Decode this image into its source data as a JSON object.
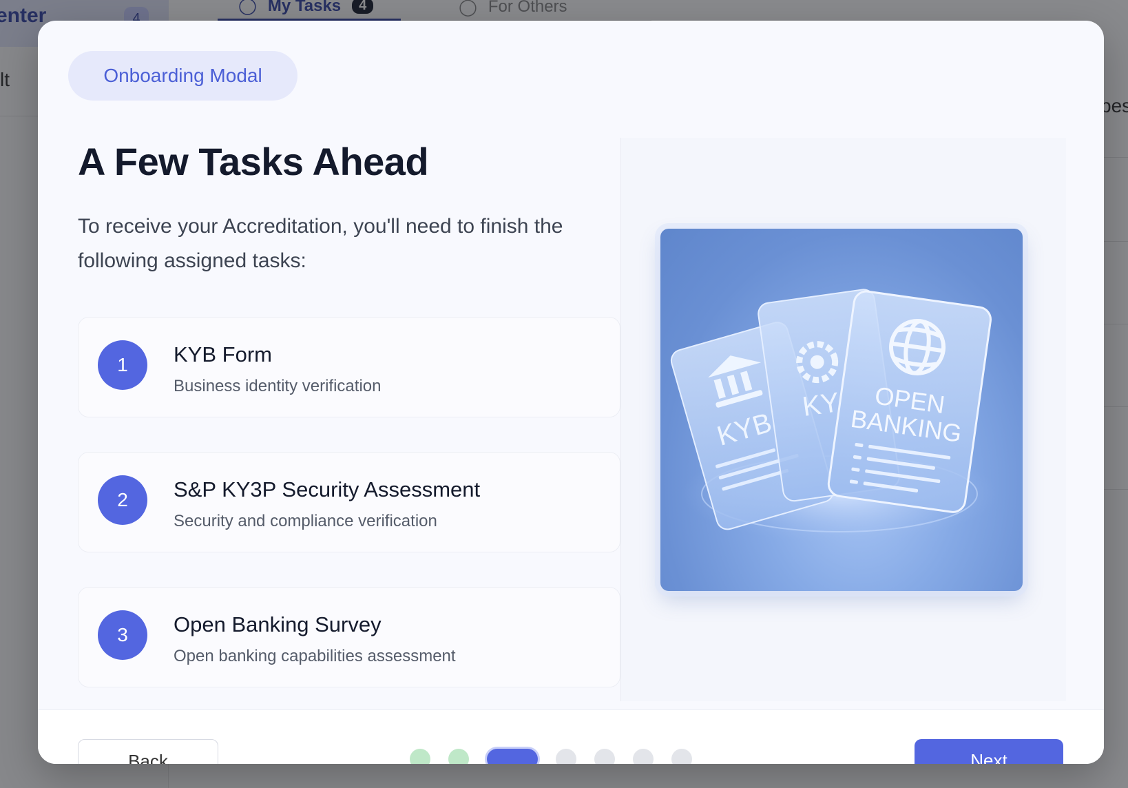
{
  "background": {
    "sidebar_active_label": "enter",
    "sidebar_active_badge": "4",
    "sidebar_item_label": "lt",
    "tab_active_label": "My Tasks",
    "tab_active_badge": "4",
    "tab_other_label": "For Others",
    "right_text": "pes"
  },
  "modal": {
    "pill_label": "Onboarding Modal",
    "title": "A Few Tasks Ahead",
    "intro": "To receive your Accreditation, you'll need to finish the following assigned tasks:",
    "tasks": [
      {
        "number": "1",
        "title": "KYB Form",
        "subtitle": "Business identity verification"
      },
      {
        "number": "2",
        "title": "S&P KY3P Security Assessment",
        "subtitle": "Security and compliance verification"
      },
      {
        "number": "3",
        "title": "Open Banking Survey",
        "subtitle": "Open banking capabilities assessment"
      }
    ],
    "illustration": {
      "card_labels": [
        "KYB",
        "KY",
        "OPEN",
        "BANKING"
      ],
      "icons": [
        "bank-icon",
        "gear-icon",
        "globe-icon"
      ]
    },
    "footer": {
      "back_label": "Back",
      "next_label": "Next",
      "step_current": 3,
      "step_total": 7
    }
  }
}
